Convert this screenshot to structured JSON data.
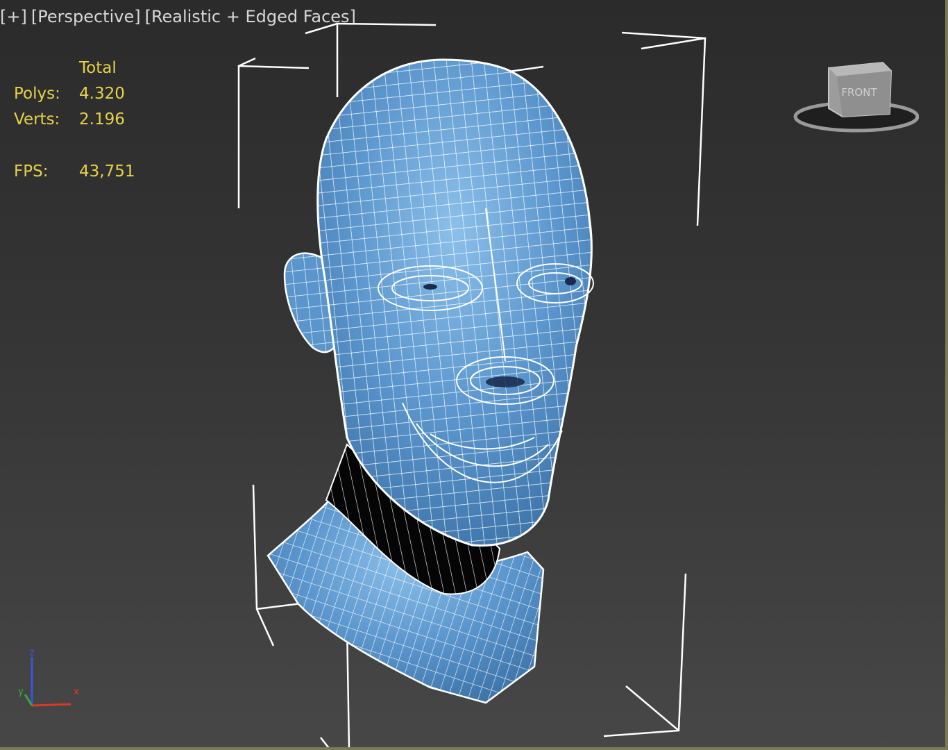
{
  "viewport": {
    "labels": {
      "plus": "[+]",
      "view": "[Perspective]",
      "shading": "[Realistic + Edged Faces]"
    }
  },
  "stats": {
    "header": "Total",
    "polys_label": "Polys:",
    "polys_value": "4.320",
    "verts_label": "Verts:",
    "verts_value": "2.196",
    "fps_label": "FPS:",
    "fps_value": "43,751"
  },
  "viewcube": {
    "face_label": "FRONT"
  },
  "axis": {
    "x": "x",
    "y": "y",
    "z": "z"
  },
  "colors": {
    "mesh_fill": "#5a95cc",
    "wire": "#ffffff",
    "stats_text": "#e6d24a",
    "label_text": "#d8d8d8",
    "axis_x": "#d83a2a",
    "axis_y": "#3aa83a",
    "axis_z": "#3a55d8"
  }
}
